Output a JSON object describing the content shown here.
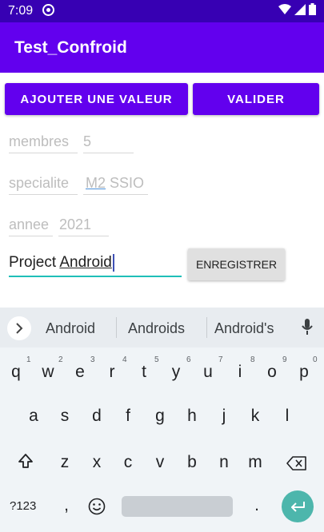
{
  "status_bar": {
    "time": "7:09"
  },
  "app_bar": {
    "title": "Test_Confroid"
  },
  "buttons": {
    "add_value": "AJOUTER UNE VALEUR",
    "validate": "VALIDER",
    "save": "ENREGISTRER"
  },
  "fields": [
    {
      "hint": "membres",
      "value": "5"
    },
    {
      "hint": "specialite",
      "value_underlined": "M2",
      "value_rest": " SSIO"
    },
    {
      "hint": "annee",
      "value": "2021"
    }
  ],
  "project": {
    "prefix": "Project ",
    "underlined": "Android"
  },
  "keyboard": {
    "suggestions": [
      "Android",
      "Androids",
      "Android's"
    ],
    "row1": [
      "q",
      "w",
      "e",
      "r",
      "t",
      "y",
      "u",
      "i",
      "o",
      "p"
    ],
    "row1_hints": [
      "1",
      "2",
      "3",
      "4",
      "5",
      "6",
      "7",
      "8",
      "9",
      "0"
    ],
    "row2": [
      "a",
      "s",
      "d",
      "f",
      "g",
      "h",
      "j",
      "k",
      "l"
    ],
    "row3": [
      "z",
      "x",
      "c",
      "v",
      "b",
      "n",
      "m"
    ],
    "symbols_key": "?123",
    "comma": ",",
    "period": "."
  },
  "colors": {
    "primary": "#6200ee",
    "primary_dark": "#3700b3",
    "accent": "#1fbfb8"
  }
}
